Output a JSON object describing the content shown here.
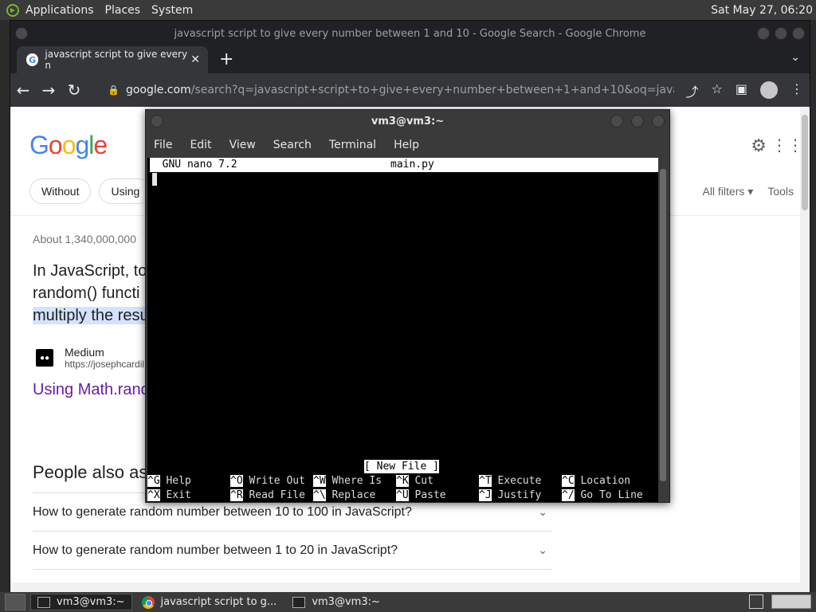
{
  "top_panel": {
    "menus": [
      "Applications",
      "Places",
      "System"
    ],
    "clock": "Sat May 27, 06:20"
  },
  "chrome": {
    "window_title": "javascript script to give every number between 1 and 10 - Google Search - Google Chrome",
    "tab_title": "javascript script to give every n",
    "url_host": "google.com",
    "url_path": "/search?q=javascript+script+to+give+every+number+between+1+and+10&oq=javascript+script+t..."
  },
  "google": {
    "chips": [
      "Without",
      "Using"
    ],
    "all_filters": "All filters",
    "tools": "Tools",
    "about": "About 1,340,000,000",
    "snippet_line1": "In JavaScript, to",
    "snippet_line2": "random() functi",
    "snippet_line3": "multiply the resu",
    "source_name": "Medium",
    "source_url": "https://josephcardil",
    "result_link": "Using Math.rand",
    "paa_title": "People also as",
    "paa_items": [
      "How to generate random number between 10 to 100 in JavaScript?",
      "How to generate random number between 1 to 20 in JavaScript?"
    ]
  },
  "terminal": {
    "title": "vm3@vm3:~",
    "menu": [
      "File",
      "Edit",
      "View",
      "Search",
      "Terminal",
      "Help"
    ],
    "nano_version": "  GNU nano 7.2",
    "filename": "main.py",
    "status": "[ New File ]",
    "shortcuts_row1": [
      {
        "key": "^G",
        "label": " Help"
      },
      {
        "key": "^O",
        "label": " Write Out"
      },
      {
        "key": "^W",
        "label": " Where Is"
      },
      {
        "key": "^K",
        "label": " Cut"
      },
      {
        "key": "^T",
        "label": " Execute"
      },
      {
        "key": "^C",
        "label": " Location"
      }
    ],
    "shortcuts_row2": [
      {
        "key": "^X",
        "label": " Exit"
      },
      {
        "key": "^R",
        "label": " Read File"
      },
      {
        "key": "^\\",
        "label": " Replace"
      },
      {
        "key": "^U",
        "label": " Paste"
      },
      {
        "key": "^J",
        "label": " Justify"
      },
      {
        "key": "^/",
        "label": " Go To Line"
      }
    ]
  },
  "taskbar": {
    "tasks": [
      "vm3@vm3:~",
      "javascript script to g...",
      "vm3@vm3:~"
    ]
  }
}
